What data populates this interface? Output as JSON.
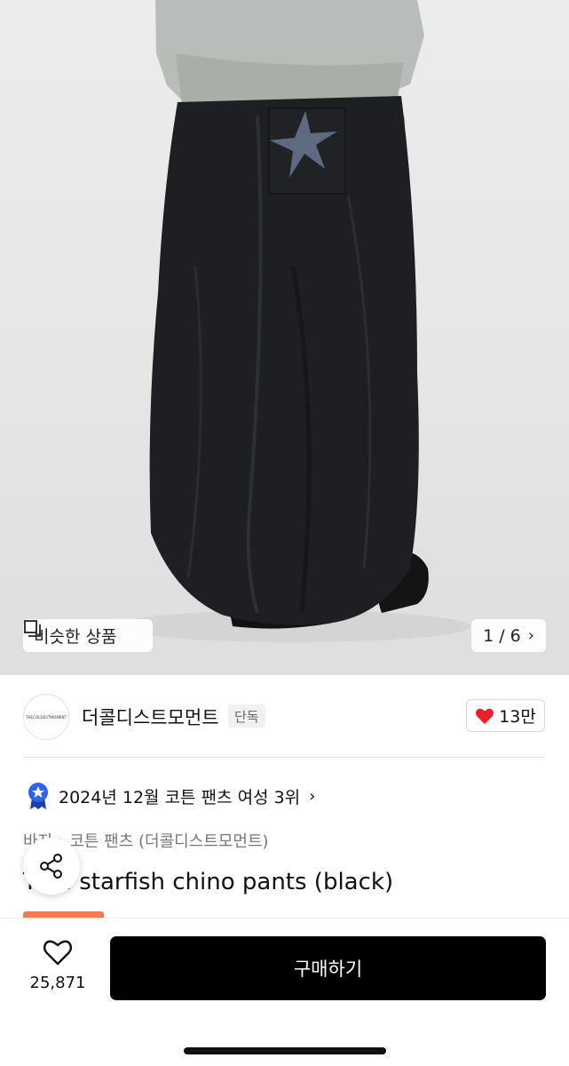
{
  "gallery": {
    "similar_products_label": "비슷한 상품",
    "page_indicator": "1 / 6"
  },
  "seller": {
    "name": "더콜디스트모먼트",
    "logo_text": "THECOLDESTMOMENT",
    "badge": "단독",
    "like_count": "13만",
    "like_color": "#e8222b"
  },
  "ranking": {
    "text": "2024년 12월 코튼 팬츠 여성 3위"
  },
  "breadcrumb": {
    "level1": "바지",
    "level2": "코튼 팬츠 (더콜디스트모먼트)"
  },
  "product": {
    "title": "TCM starfish chino pants (black)",
    "sale_tag_color": "#f07c52"
  },
  "bottom_bar": {
    "wishlist_count": "25,871",
    "buy_label": "구매하기"
  }
}
